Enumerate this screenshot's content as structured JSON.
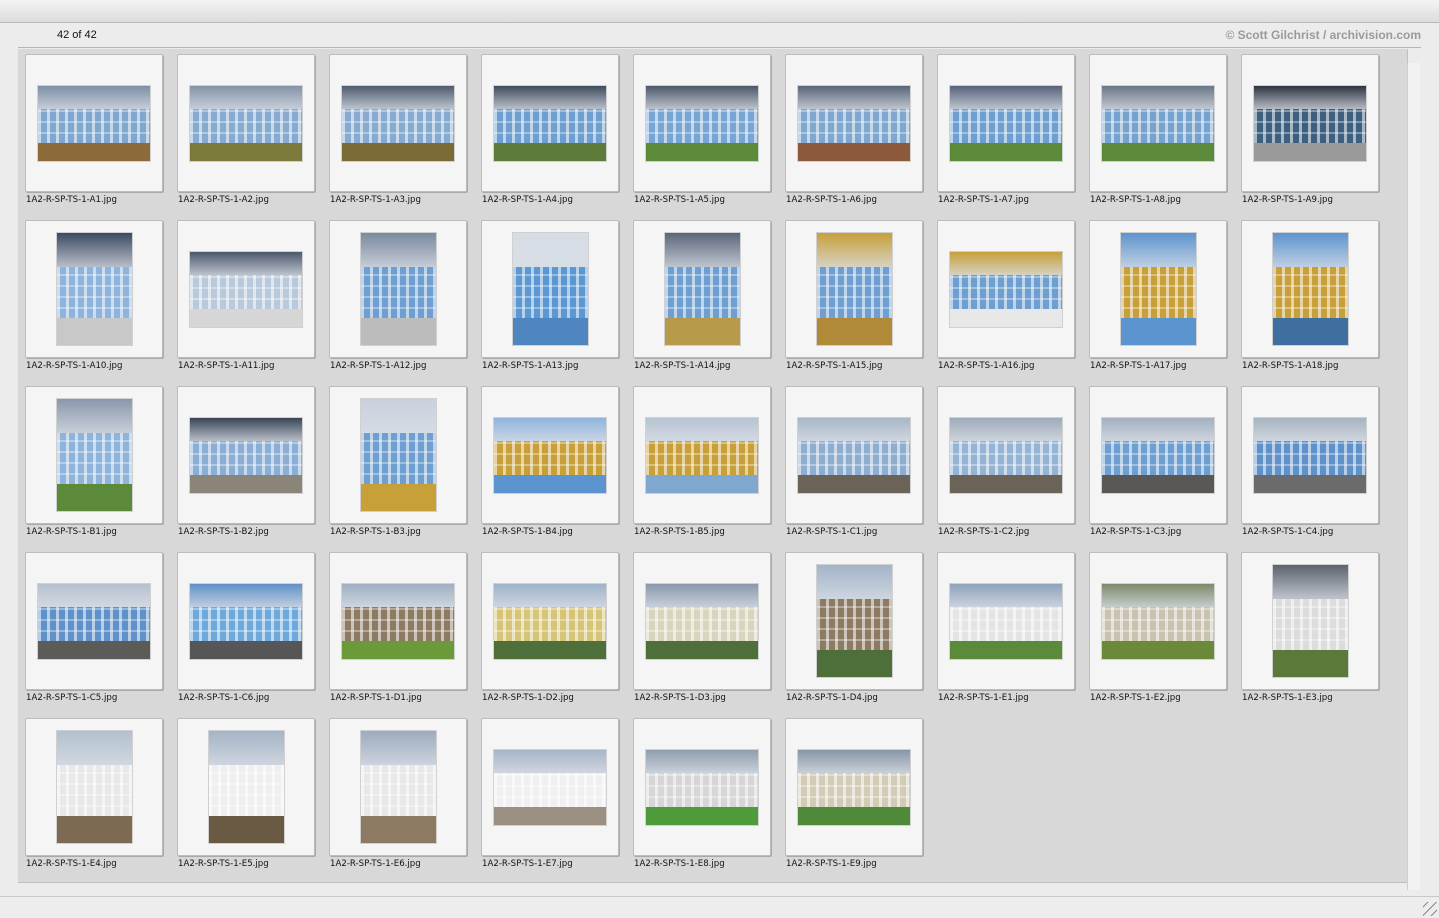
{
  "window": {
    "counter": "42 of 42",
    "copyright": "© Scott Gilchrist / archivision.com"
  },
  "colors": {
    "sky_gray": "#6b7686",
    "sky_light": "#b7c4d3",
    "facade_blue": "#6f9fd0",
    "gold": "#c7a03a",
    "lawn": "#5b8a3a",
    "pavement": "#6b6258",
    "stone": "#8c7a62",
    "yellow_facade": "#d6c576"
  },
  "thumbnails": [
    {
      "file": "1A2-R-SP-TS-1-A1.jpg",
      "orientation": "landscape",
      "sky": "#7f8fa6",
      "bldg": "#7fa7cf",
      "ground": "#8c6a3a"
    },
    {
      "file": "1A2-R-SP-TS-1-A2.jpg",
      "orientation": "landscape",
      "sky": "#8593a8",
      "bldg": "#86aad0",
      "ground": "#7b7a3a"
    },
    {
      "file": "1A2-R-SP-TS-1-A3.jpg",
      "orientation": "landscape",
      "sky": "#4e5c70",
      "bldg": "#86aad0",
      "ground": "#7a6a36"
    },
    {
      "file": "1A2-R-SP-TS-1-A4.jpg",
      "orientation": "landscape",
      "sky": "#3f4b5c",
      "bldg": "#6f9fd0",
      "ground": "#5f7b3a"
    },
    {
      "file": "1A2-R-SP-TS-1-A5.jpg",
      "orientation": "landscape",
      "sky": "#4c5868",
      "bldg": "#78a6d4",
      "ground": "#5b8a3a"
    },
    {
      "file": "1A2-R-SP-TS-1-A6.jpg",
      "orientation": "landscape",
      "sky": "#596577",
      "bldg": "#7fa7cf",
      "ground": "#8c5a3a"
    },
    {
      "file": "1A2-R-SP-TS-1-A7.jpg",
      "orientation": "landscape",
      "sky": "#55627a",
      "bldg": "#6f9fd0",
      "ground": "#5b8a3a"
    },
    {
      "file": "1A2-R-SP-TS-1-A8.jpg",
      "orientation": "landscape",
      "sky": "#6b7686",
      "bldg": "#76a2cf",
      "ground": "#5b8a3a"
    },
    {
      "file": "1A2-R-SP-TS-1-A9.jpg",
      "orientation": "landscape",
      "sky": "#2f3540",
      "bldg": "#3f5f7f",
      "ground": "#9a9a9a"
    },
    {
      "file": "1A2-R-SP-TS-1-A10.jpg",
      "orientation": "portrait",
      "sky": "#3b4a63",
      "bldg": "#8fb4dc",
      "ground": "#c8c8c8"
    },
    {
      "file": "1A2-R-SP-TS-1-A11.jpg",
      "orientation": "landscape",
      "sky": "#4b586b",
      "bldg": "#b9c9dc",
      "ground": "#d6d6d6"
    },
    {
      "file": "1A2-R-SP-TS-1-A12.jpg",
      "orientation": "portrait",
      "sky": "#7a8a9f",
      "bldg": "#6f9fd0",
      "ground": "#bcbcbc"
    },
    {
      "file": "1A2-R-SP-TS-1-A13.jpg",
      "orientation": "portrait",
      "sky": "#d7dde5",
      "bldg": "#5b98d2",
      "ground": "#4f86c0"
    },
    {
      "file": "1A2-R-SP-TS-1-A14.jpg",
      "orientation": "portrait",
      "sky": "#5a667a",
      "bldg": "#6f9fd0",
      "ground": "#b79b4a"
    },
    {
      "file": "1A2-R-SP-TS-1-A15.jpg",
      "orientation": "portrait",
      "sky": "#c7a03a",
      "bldg": "#6f9fd0",
      "ground": "#b08a38"
    },
    {
      "file": "1A2-R-SP-TS-1-A16.jpg",
      "orientation": "landscape",
      "sky": "#c7a03a",
      "bldg": "#6f9fd0",
      "ground": "#e8e8e8"
    },
    {
      "file": "1A2-R-SP-TS-1-A17.jpg",
      "orientation": "portrait",
      "sky": "#5c94cf",
      "bldg": "#c7a03a",
      "ground": "#5c94cf"
    },
    {
      "file": "1A2-R-SP-TS-1-A18.jpg",
      "orientation": "portrait",
      "sky": "#5c94cf",
      "bldg": "#c7a03a",
      "ground": "#3f6f9f"
    },
    {
      "file": "1A2-R-SP-TS-1-B1.jpg",
      "orientation": "portrait",
      "sky": "#8a98ab",
      "bldg": "#8fb4dc",
      "ground": "#5b8a3a"
    },
    {
      "file": "1A2-R-SP-TS-1-B2.jpg",
      "orientation": "landscape",
      "sky": "#394556",
      "bldg": "#8aaed4",
      "ground": "#8a8578"
    },
    {
      "file": "1A2-R-SP-TS-1-B3.jpg",
      "orientation": "portrait",
      "sky": "#c9d1dc",
      "bldg": "#6f9fd0",
      "ground": "#c7a03a"
    },
    {
      "file": "1A2-R-SP-TS-1-B4.jpg",
      "orientation": "landscape",
      "sky": "#8fb4dc",
      "bldg": "#c7a03a",
      "ground": "#5c94cf"
    },
    {
      "file": "1A2-R-SP-TS-1-B5.jpg",
      "orientation": "landscape",
      "sky": "#b7c4d3",
      "bldg": "#c7a03a",
      "ground": "#7fa7cf"
    },
    {
      "file": "1A2-R-SP-TS-1-C1.jpg",
      "orientation": "landscape",
      "sky": "#a9b6c7",
      "bldg": "#8eaed0",
      "ground": "#6b6258"
    },
    {
      "file": "1A2-R-SP-TS-1-C2.jpg",
      "orientation": "landscape",
      "sky": "#9fabba",
      "bldg": "#95b4d4",
      "ground": "#6b6258"
    },
    {
      "file": "1A2-R-SP-TS-1-C3.jpg",
      "orientation": "landscape",
      "sky": "#a3b0c0",
      "bldg": "#6f9fd0",
      "ground": "#5a5854"
    },
    {
      "file": "1A2-R-SP-TS-1-C4.jpg",
      "orientation": "landscape",
      "sky": "#a7b3c2",
      "bldg": "#5f92c8",
      "ground": "#6b6b6b"
    },
    {
      "file": "1A2-R-SP-TS-1-C5.jpg",
      "orientation": "landscape",
      "sky": "#b6c1cf",
      "bldg": "#5f92c8",
      "ground": "#5d5b58"
    },
    {
      "file": "1A2-R-SP-TS-1-C6.jpg",
      "orientation": "landscape",
      "sky": "#5f92c8",
      "bldg": "#6ea9dc",
      "ground": "#565656"
    },
    {
      "file": "1A2-R-SP-TS-1-D1.jpg",
      "orientation": "landscape",
      "sky": "#9fb0c2",
      "bldg": "#8c7a62",
      "ground": "#6a9a3a"
    },
    {
      "file": "1A2-R-SP-TS-1-D2.jpg",
      "orientation": "landscape",
      "sky": "#9fb3c9",
      "bldg": "#d6c576",
      "ground": "#4f6f3a"
    },
    {
      "file": "1A2-R-SP-TS-1-D3.jpg",
      "orientation": "landscape",
      "sky": "#8a98ab",
      "bldg": "#d9d4bd",
      "ground": "#4f6f3a"
    },
    {
      "file": "1A2-R-SP-TS-1-D4.jpg",
      "orientation": "portrait",
      "sky": "#a3b4c8",
      "bldg": "#8c7a62",
      "ground": "#4f6f3a"
    },
    {
      "file": "1A2-R-SP-TS-1-E1.jpg",
      "orientation": "landscape",
      "sky": "#8fa3bb",
      "bldg": "#e4e4e4",
      "ground": "#5b8a3a"
    },
    {
      "file": "1A2-R-SP-TS-1-E2.jpg",
      "orientation": "landscape",
      "sky": "#7d8a6a",
      "bldg": "#c9c2b0",
      "ground": "#6a8a3a"
    },
    {
      "file": "1A2-R-SP-TS-1-E3.jpg",
      "orientation": "portrait",
      "sky": "#5d636d",
      "bldg": "#dcdcdc",
      "ground": "#5b7a3a"
    },
    {
      "file": "1A2-R-SP-TS-1-E4.jpg",
      "orientation": "portrait",
      "sky": "#b3c0ce",
      "bldg": "#e8e8e8",
      "ground": "#7d6a52"
    },
    {
      "file": "1A2-R-SP-TS-1-E5.jpg",
      "orientation": "portrait",
      "sky": "#a5b4c5",
      "bldg": "#efefef",
      "ground": "#6a5a44"
    },
    {
      "file": "1A2-R-SP-TS-1-E6.jpg",
      "orientation": "portrait",
      "sky": "#9dabbd",
      "bldg": "#e8e8e8",
      "ground": "#8c7a62"
    },
    {
      "file": "1A2-R-SP-TS-1-E7.jpg",
      "orientation": "landscape",
      "sky": "#a7b6c7",
      "bldg": "#f0f0f0",
      "ground": "#9a8f80"
    },
    {
      "file": "1A2-R-SP-TS-1-E8.jpg",
      "orientation": "landscape",
      "sky": "#8f9eae",
      "bldg": "#d6d6d6",
      "ground": "#4f9a3a"
    },
    {
      "file": "1A2-R-SP-TS-1-E9.jpg",
      "orientation": "landscape",
      "sky": "#8796a6",
      "bldg": "#d2cbb5",
      "ground": "#4f8a3a"
    }
  ]
}
